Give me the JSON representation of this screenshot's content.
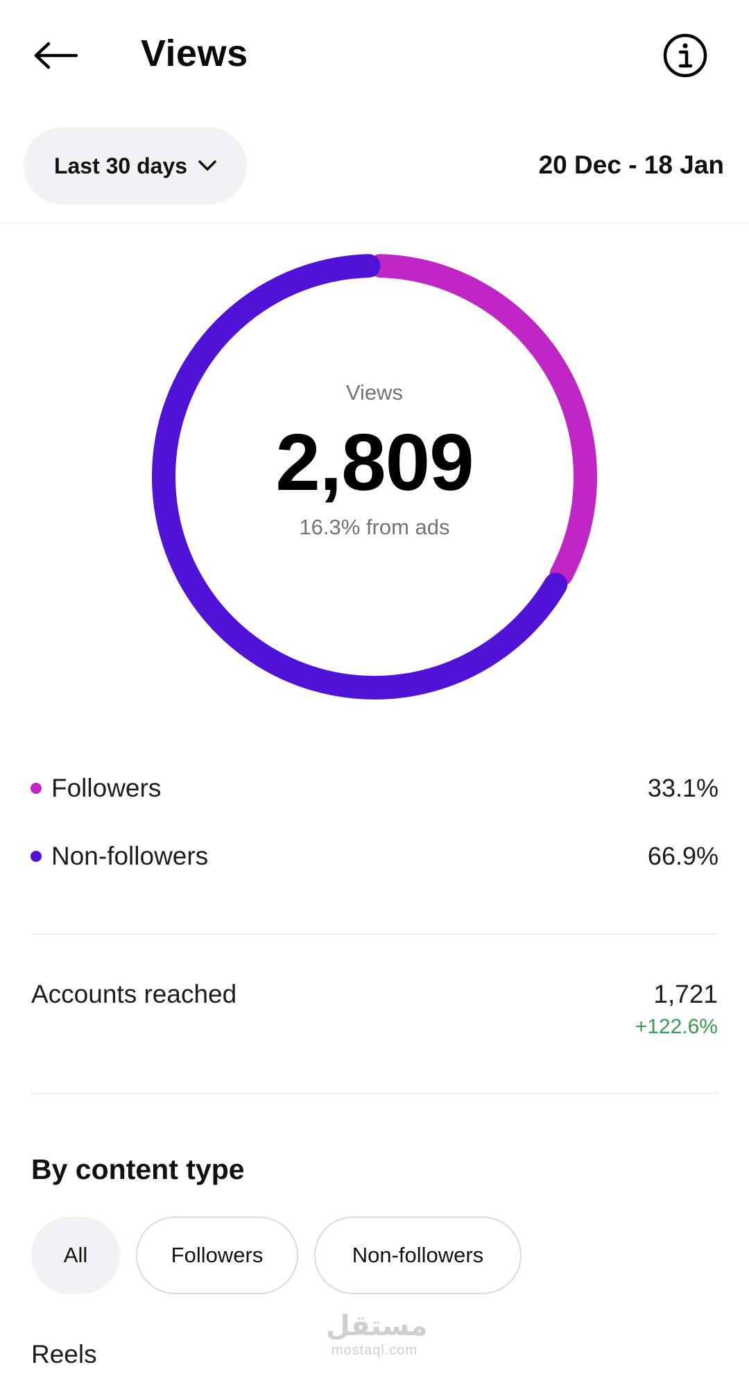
{
  "header": {
    "title": "Views",
    "back_icon": "arrow-left-icon",
    "info_icon": "info-icon"
  },
  "filter": {
    "period_label": "Last 30 days",
    "date_range": "20 Dec - 18 Jan"
  },
  "summary": {
    "label": "Views",
    "value": "2,809",
    "subtext": "16.3% from ads"
  },
  "chart_data": {
    "type": "pie",
    "style": "donut",
    "title": "Views",
    "categories": [
      "Followers",
      "Non-followers"
    ],
    "values": [
      33.1,
      66.9
    ],
    "colors": [
      "#c026c5",
      "#4f12d6"
    ],
    "legend": "below"
  },
  "legend": [
    {
      "label": "Followers",
      "value": "33.1%",
      "color": "#c026c5"
    },
    {
      "label": "Non-followers",
      "value": "66.9%",
      "color": "#4f12d6"
    }
  ],
  "reach": {
    "label": "Accounts reached",
    "value": "1,721",
    "change": "+122.6%"
  },
  "content_type": {
    "title": "By content type",
    "chips": [
      {
        "label": "All",
        "active": true
      },
      {
        "label": "Followers",
        "active": false
      },
      {
        "label": "Non-followers",
        "active": false
      }
    ],
    "first_row_label": "Reels"
  },
  "watermark": {
    "arabic": "مستقل",
    "latin": "mostaql.com"
  },
  "colors": {
    "followers": "#c026c5",
    "non_followers": "#4f12d6",
    "positive": "#3a9a4d",
    "pill_bg": "#f0f2f5"
  }
}
